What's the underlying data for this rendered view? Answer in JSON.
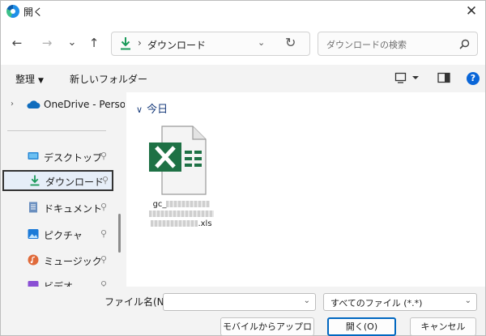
{
  "window": {
    "title": "開く",
    "close_symbol": "✕"
  },
  "nav": {
    "back_symbol": "←",
    "forward_symbol": "→",
    "recent_symbol": "⌄",
    "up_symbol": "↑",
    "breadcrumb_separator": "›",
    "breadcrumb": "ダウンロード",
    "address_dropdown_symbol": "⌄",
    "refresh_symbol": "↻",
    "search_placeholder": "ダウンロードの検索"
  },
  "commands": {
    "organize": "整理",
    "organize_caret": "▼",
    "new_folder": "新しいフォルダー",
    "help": "?"
  },
  "sidebar": {
    "onedrive_arrow": "›",
    "items": [
      {
        "label": "OneDrive - Perso",
        "icon": "cloud-icon"
      },
      {
        "label": "デスクトップ",
        "icon": "desktop-icon",
        "pinned": true
      },
      {
        "label": "ダウンロード",
        "icon": "download-icon",
        "pinned": true,
        "selected": true
      },
      {
        "label": "ドキュメント",
        "icon": "document-icon",
        "pinned": true
      },
      {
        "label": "ピクチャ",
        "icon": "picture-icon",
        "pinned": true
      },
      {
        "label": "ミュージック",
        "icon": "music-icon",
        "pinned": true
      },
      {
        "label": "ビデオ",
        "icon": "video-icon",
        "pinned": true
      }
    ],
    "pin_symbol": "📌"
  },
  "content": {
    "group_chevron": "∨",
    "group_label": "今日",
    "files": [
      {
        "name_prefix": "gc_",
        "name_suffix": ".xls",
        "icon": "excel-file-icon"
      }
    ]
  },
  "footer": {
    "filename_label": "ファイル名(N):",
    "filename_value": "",
    "dropdown_symbol": "⌄",
    "filetype_value": "すべてのファイル (*.*)",
    "mobile_upload_button": "モバイルからアップロード",
    "open_button": "開く(O)",
    "cancel_button": "キャンセル"
  },
  "colors": {
    "accent": "#0067c0",
    "excel_green": "#1e7145",
    "help_blue": "#0a66d8"
  }
}
